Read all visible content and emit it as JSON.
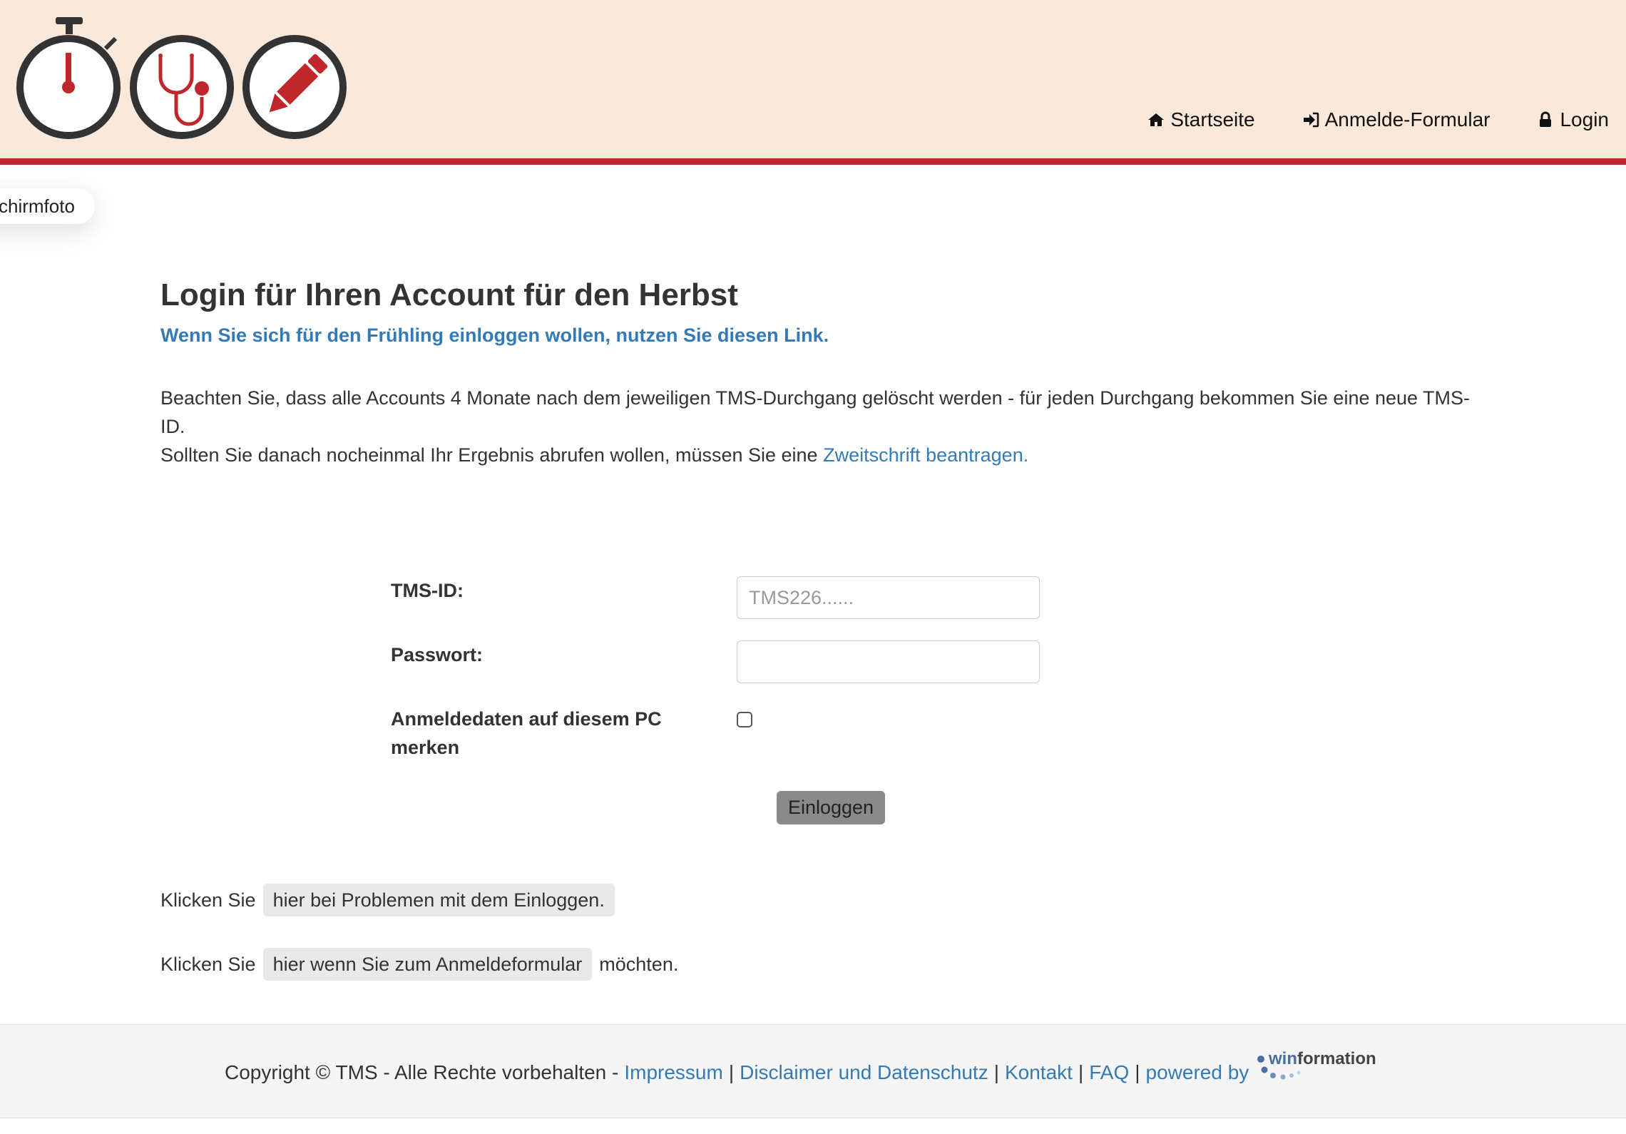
{
  "header": {
    "nav": [
      {
        "label": "Startseite",
        "icon": "home-icon"
      },
      {
        "label": "Anmelde-Formular",
        "icon": "sign-in-icon"
      },
      {
        "label": "Login",
        "icon": "lock-icon"
      }
    ]
  },
  "screenshot_tab": {
    "label": "chirmfoto"
  },
  "main": {
    "title": "Login für Ihren Account für den Herbst",
    "season_link": "Wenn Sie sich für den Frühling einloggen wollen, nutzen Sie diesen Link.",
    "notice_line1": "Beachten Sie, dass alle Accounts 4 Monate nach dem jeweiligen TMS-Durchgang gelöscht werden - für jeden Durchgang bekommen Sie eine neue TMS-ID.",
    "notice_line2_prefix": "Sollten Sie danach nocheinmal Ihr Ergebnis abrufen wollen, müssen Sie eine",
    "notice_line2_link": "Zweitschrift beantragen."
  },
  "form": {
    "tms_id_label": "TMS-ID:",
    "tms_id_placeholder": "TMS226......",
    "tms_id_value": "",
    "password_label": "Passwort:",
    "password_value": "",
    "remember_label": "Anmeldedaten auf diesem PC merken",
    "remember_checked": false,
    "submit_label": "Einloggen"
  },
  "help": {
    "row1_prefix": "Klicken Sie",
    "row1_link": "hier bei Problemen mit dem Einloggen.",
    "row2_prefix": "Klicken Sie",
    "row2_link": "hier wenn Sie zum Anmeldeformular",
    "row2_suffix": "möchten."
  },
  "footer": {
    "copyright": "Copyright © TMS - Alle Rechte vorbehalten -",
    "links": [
      "Impressum",
      "Disclaimer und Datenschutz",
      "Kontakt",
      "FAQ",
      "powered by"
    ],
    "separator": "|",
    "brand": "winformation"
  },
  "colors": {
    "header_bg": "#fae9db",
    "accent_red": "#c0272d",
    "link_blue": "#337ab7",
    "logo_gray": "#333333"
  }
}
